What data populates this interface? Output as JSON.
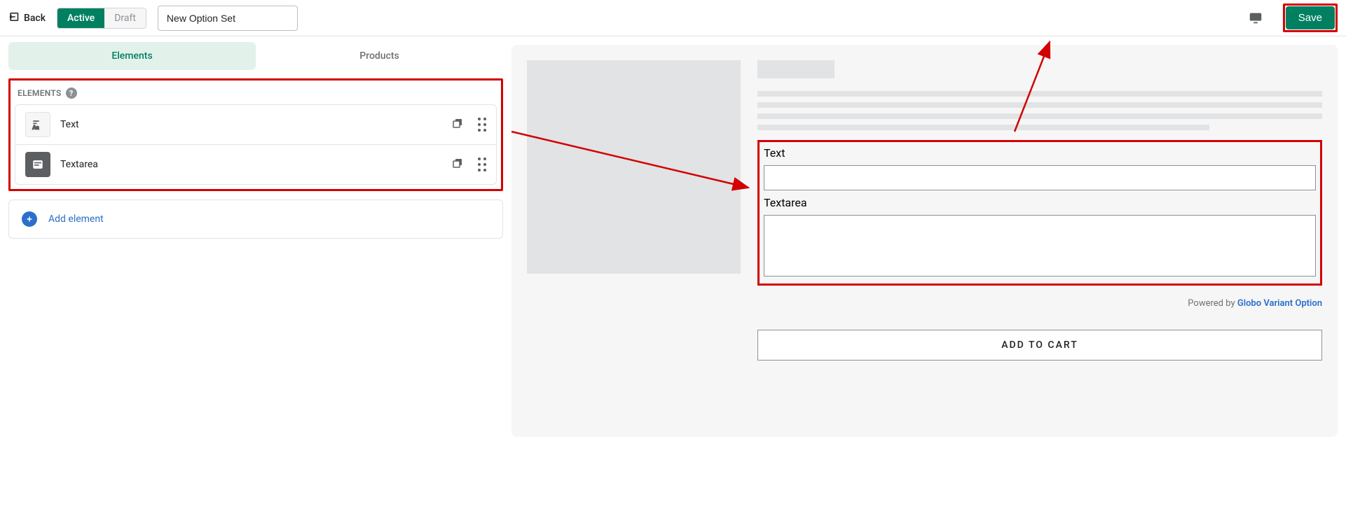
{
  "topbar": {
    "back_label": "Back",
    "active_label": "Active",
    "draft_label": "Draft",
    "name_value": "New Option Set",
    "save_label": "Save"
  },
  "tabs": {
    "elements": "Elements",
    "products": "Products"
  },
  "section": {
    "title": "ELEMENTS",
    "items": [
      {
        "label": "Text"
      },
      {
        "label": "Textarea"
      }
    ],
    "add_label": "Add element"
  },
  "preview": {
    "text_label": "Text",
    "textarea_label": "Textarea",
    "powered_prefix": "Powered by ",
    "powered_brand": "Globo Variant Option",
    "cart_label": "ADD TO CART"
  }
}
